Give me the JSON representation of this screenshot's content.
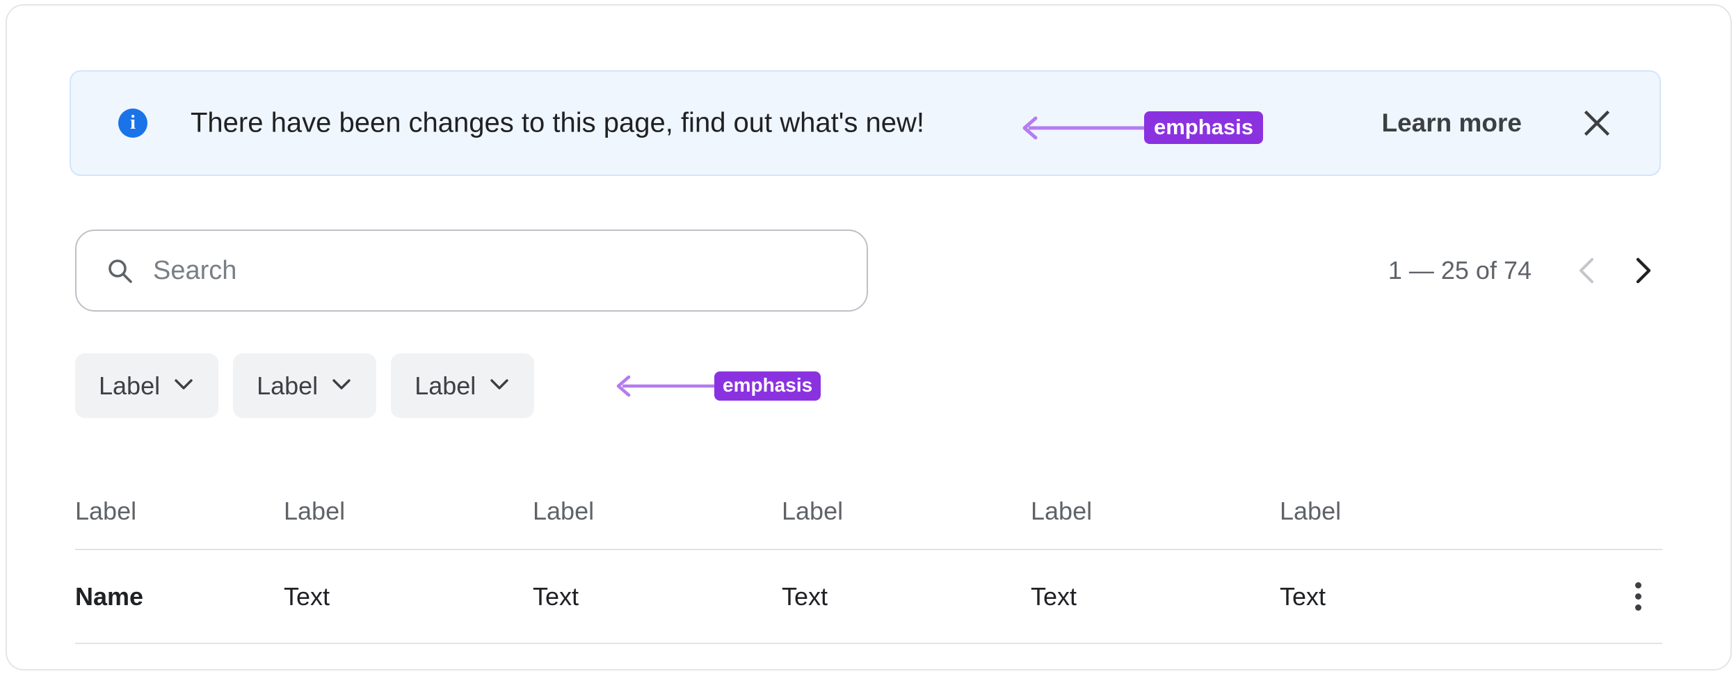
{
  "banner": {
    "icon": "info-circle-icon",
    "message": "There have been changes to this page, find out what's new!",
    "learn_more_label": "Learn more",
    "close_icon": "close-icon",
    "background_color": "#eff6fe",
    "border_color": "#d2e6fb",
    "icon_color": "#1a73e8"
  },
  "annotations": [
    {
      "label": "emphasis",
      "color": "#8b32e0",
      "arrow_color": "#b57cf0",
      "points_to": "banner-message"
    },
    {
      "label": "emphasis",
      "color": "#8b32e0",
      "arrow_color": "#b57cf0",
      "points_to": "filter-chips"
    }
  ],
  "search": {
    "icon": "search-icon",
    "value": "",
    "placeholder": "Search"
  },
  "pagination": {
    "range_text": "1 — 25 of 74",
    "prev_icon": "chevron-left-icon",
    "next_icon": "chevron-right-icon",
    "prev_enabled": false,
    "next_enabled": true
  },
  "filters": [
    {
      "label": "Label",
      "icon": "chevron-down-icon"
    },
    {
      "label": "Label",
      "icon": "chevron-down-icon"
    },
    {
      "label": "Label",
      "icon": "chevron-down-icon"
    }
  ],
  "table": {
    "columns": [
      "Label",
      "Label",
      "Label",
      "Label",
      "Label",
      "Label"
    ],
    "rows": [
      {
        "cells": [
          "Name",
          "Text",
          "Text",
          "Text",
          "Text",
          "Text"
        ],
        "overflow_icon": "more-vertical-icon"
      }
    ]
  }
}
